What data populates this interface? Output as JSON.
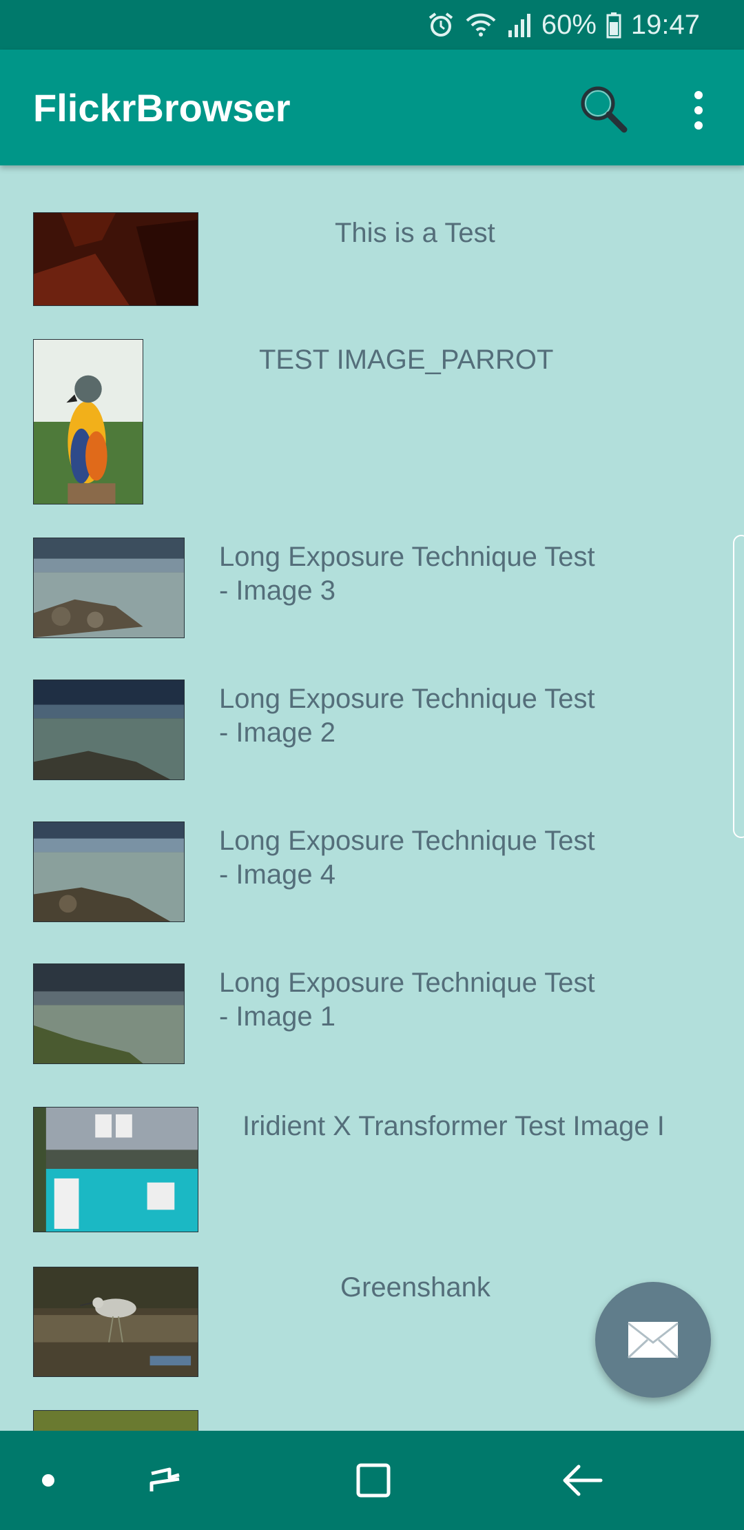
{
  "status_bar": {
    "battery_percent": "60%",
    "time": "19:47",
    "icons": [
      "alarm-icon",
      "wifi-icon",
      "signal-icon",
      "battery-icon"
    ]
  },
  "app_bar": {
    "title": "FlickrBrowser",
    "actions": [
      "search-icon",
      "more-vert-icon"
    ]
  },
  "photos": [
    {
      "title": "This is a Test",
      "thumbnail": "dark red rocks"
    },
    {
      "title": "TEST IMAGE_PARROT",
      "thumbnail": "parrot"
    },
    {
      "title": "Long Exposure Technique Test\n- Image 3",
      "thumbnail": "lake with rocks"
    },
    {
      "title": "Long Exposure Technique Test\n- Image 2",
      "thumbnail": "lake with rocks"
    },
    {
      "title": "Long Exposure Technique Test\n- Image 4",
      "thumbnail": "lake with rocks"
    },
    {
      "title": "Long Exposure Technique Test\n- Image 1",
      "thumbnail": "lake with rocks"
    },
    {
      "title": "Iridient X Transformer Test Image I",
      "thumbnail": "teal house"
    },
    {
      "title": "Greenshank",
      "thumbnail": "wading bird"
    }
  ],
  "fab": {
    "icon": "envelope-icon"
  },
  "nav_bar": {
    "buttons": [
      "dot-icon",
      "recent-apps-icon",
      "home-icon",
      "back-icon"
    ]
  },
  "colors": {
    "status_bar": "#00796b",
    "app_bar": "#009688",
    "background": "#b2dfdb",
    "text": "#546e7a",
    "fab": "#607d8b"
  }
}
